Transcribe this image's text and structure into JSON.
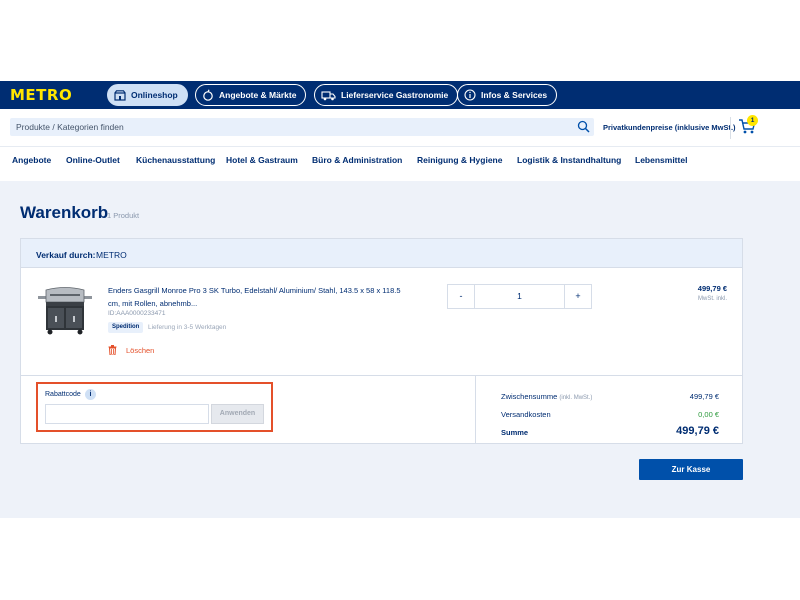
{
  "header": {
    "logo": "METRO",
    "tabs": [
      {
        "label": "Onlineshop"
      },
      {
        "label": "Angebote & Märkte"
      },
      {
        "label": "Lieferservice Gastronomie"
      },
      {
        "label": "Infos & Services"
      }
    ],
    "search_placeholder": "Produkte / Kategorien finden",
    "price_mode": "Privatkundenpreise (inklusive MwSt.)",
    "cart_count": "1"
  },
  "categories": [
    "Angebote",
    "Online-Outlet",
    "Küchenausstattung",
    "Hotel & Gastraum",
    "Büro & Administration",
    "Reinigung & Hygiene",
    "Logistik & Instandhaltung",
    "Lebensmittel"
  ],
  "cart": {
    "title": "Warenkorb",
    "count_label": "1 Produkt",
    "seller_label": "Verkauf durch:",
    "seller_name": "METRO",
    "item": {
      "name": "Enders Gasgrill Monroe Pro 3 SK Turbo, Edelstahl/ Aluminium/ Stahl, 143.5 x 58 x 118.5 cm, mit Rollen, abnehmb...",
      "id": "ID:AAA0000233471",
      "shipping_badge": "Spedition",
      "delivery": "Lieferung in 3-5 Werktagen",
      "delete_label": "Löschen",
      "qty_minus": "-",
      "quantity": "1",
      "qty_plus": "+",
      "price": "499,79 €",
      "tax_note": "MwSt. inkl."
    },
    "coupon": {
      "label": "Rabattcode",
      "info": "i",
      "value": "",
      "apply_label": "Anwenden"
    },
    "summary": {
      "subtotal_label": "Zwischensumme",
      "subtotal_note": "(inkl. MwSt.)",
      "subtotal_value": "499,79 €",
      "shipping_label": "Versandkosten",
      "shipping_value": "0,00 €",
      "total_label": "Summe",
      "total_value": "499,79 €"
    },
    "checkout_label": "Zur Kasse"
  },
  "colors": {
    "brand_blue": "#002d72",
    "brand_yellow": "#ffe600",
    "accent_blue": "#0050aa",
    "alert_red": "#e4502a",
    "success_green": "#2e9b3e"
  }
}
